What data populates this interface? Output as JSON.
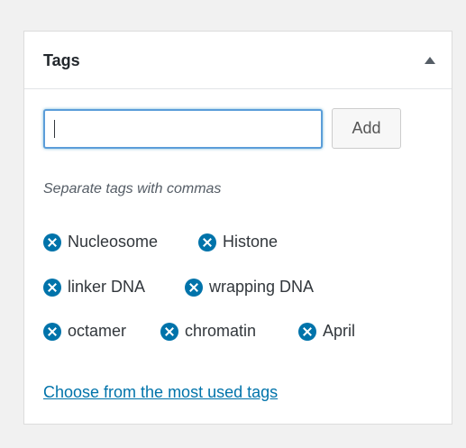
{
  "panel": {
    "title": "Tags"
  },
  "input": {
    "value": "",
    "placeholder": ""
  },
  "add_button_label": "Add",
  "hint": "Separate tags with commas",
  "tags": [
    "Nucleosome",
    "Histone",
    "linker DNA",
    "wrapping DNA",
    "octamer",
    "chromatin",
    "April"
  ],
  "most_used_link": "Choose from the most used tags",
  "colors": {
    "accent": "#0073aa",
    "focus_border": "#5b9dd9"
  }
}
